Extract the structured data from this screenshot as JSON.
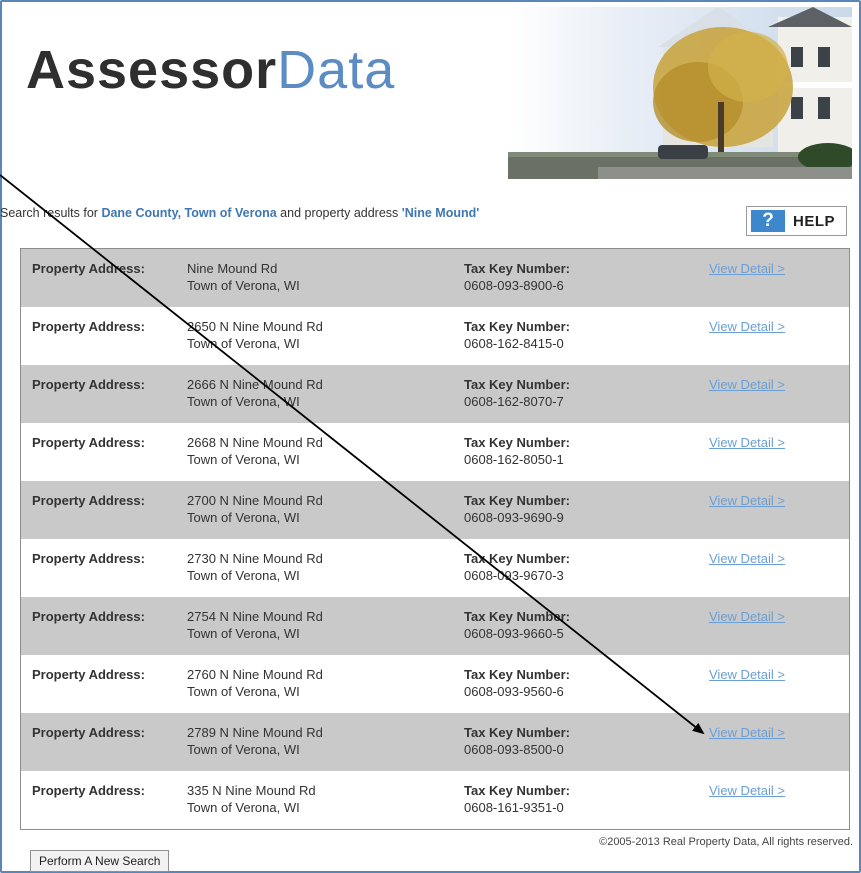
{
  "logo": {
    "part1": "Assessor",
    "part2": "Data"
  },
  "search": {
    "prefix": "Search results for ",
    "location": "Dane County, Town of Verona",
    "middle": " and property address ",
    "query": "'Nine Mound'"
  },
  "help": {
    "icon": "?",
    "label": "HELP"
  },
  "labels": {
    "property_address": "Property Address:",
    "tax_key": "Tax Key Number:",
    "view_detail": "View Detail >"
  },
  "results": [
    {
      "address": "Nine Mound Rd",
      "city": "Town of Verona, WI",
      "tax_key": "0608-093-8900-6"
    },
    {
      "address": "2650 N Nine Mound Rd",
      "city": "Town of Verona, WI",
      "tax_key": "0608-162-8415-0"
    },
    {
      "address": "2666 N Nine Mound Rd",
      "city": "Town of Verona, WI",
      "tax_key": "0608-162-8070-7"
    },
    {
      "address": "2668 N Nine Mound Rd",
      "city": "Town of Verona, WI",
      "tax_key": "0608-162-8050-1"
    },
    {
      "address": "2700 N Nine Mound Rd",
      "city": "Town of Verona, WI",
      "tax_key": "0608-093-9690-9"
    },
    {
      "address": "2730 N Nine Mound Rd",
      "city": "Town of Verona, WI",
      "tax_key": "0608-093-9670-3"
    },
    {
      "address": "2754 N Nine Mound Rd",
      "city": "Town of Verona, WI",
      "tax_key": "0608-093-9660-5"
    },
    {
      "address": "2760 N Nine Mound Rd",
      "city": "Town of Verona, WI",
      "tax_key": "0608-093-9560-6"
    },
    {
      "address": "2789 N Nine Mound Rd",
      "city": "Town of Verona, WI",
      "tax_key": "0608-093-8500-0"
    },
    {
      "address": "335 N Nine Mound Rd",
      "city": "Town of Verona, WI",
      "tax_key": "0608-161-9351-0"
    }
  ],
  "footer": {
    "copyright": "©2005-2013 Real Property Data, All rights reserved.",
    "new_search_label": "Perform A New Search"
  },
  "colors": {
    "accent": "#5b8cc4",
    "link": "#6b9fd4",
    "row_alt": "#c9c9c9",
    "help_icon": "#3d87cc"
  }
}
